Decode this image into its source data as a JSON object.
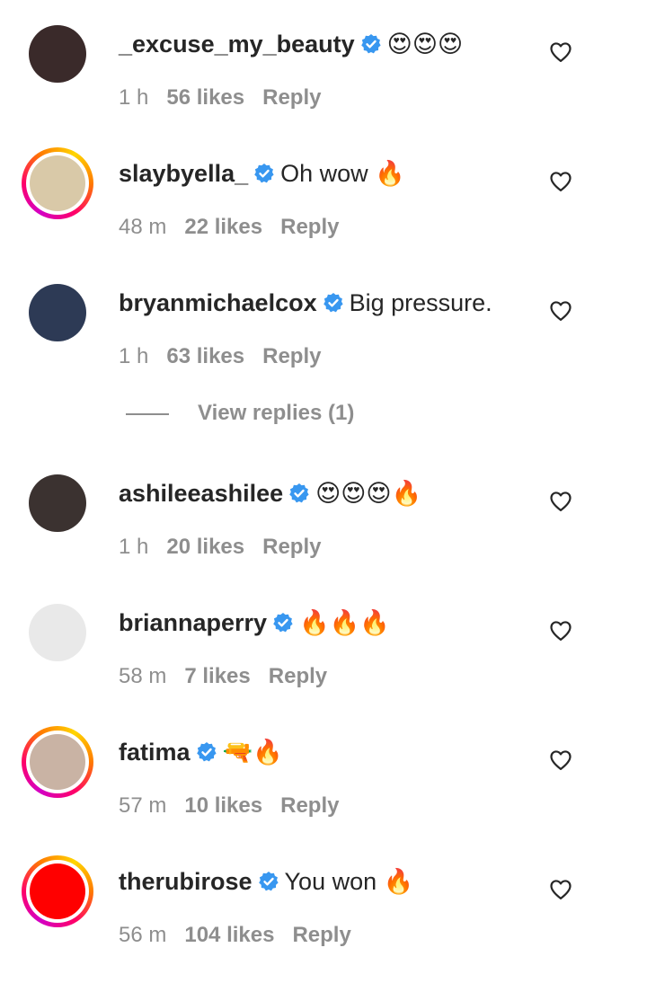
{
  "comments": [
    {
      "username": "_excuse_my_beauty",
      "text": "😍😍😍",
      "time": "1 h",
      "likes": "56 likes",
      "reply": "Reply",
      "avatar_color": "#3a2a2a",
      "story_ring": false
    },
    {
      "username": "slaybyella_",
      "text": "Oh wow 🔥",
      "time": "48 m",
      "likes": "22 likes",
      "reply": "Reply",
      "avatar_color": "#d9c9a8",
      "story_ring": true
    },
    {
      "username": "bryanmichaelcox",
      "text": "Big pressure.",
      "time": "1 h",
      "likes": "63 likes",
      "reply": "Reply",
      "avatar_color": "#2d3a55",
      "story_ring": false,
      "view_replies": "View replies (1)"
    },
    {
      "username": "ashileeashilee",
      "text": "😍😍😍🔥",
      "time": "1 h",
      "likes": "20 likes",
      "reply": "Reply",
      "avatar_color": "#3b3230",
      "story_ring": false
    },
    {
      "username": "briannaperry",
      "text": "🔥🔥🔥",
      "time": "58 m",
      "likes": "7 likes",
      "reply": "Reply",
      "avatar_color": "#e9e9e9",
      "story_ring": false
    },
    {
      "username": "fatima",
      "text": "🔫🔥",
      "time": "57 m",
      "likes": "10 likes",
      "reply": "Reply",
      "avatar_color": "#c9b3a4",
      "story_ring": true
    },
    {
      "username": "therubirose",
      "text": "You won 🔥",
      "time": "56 m",
      "likes": "104 likes",
      "reply": "Reply",
      "avatar_color": "#ff0000",
      "story_ring": true
    }
  ],
  "colors": {
    "verified": "#3897f0",
    "meta_text": "#8e8e8e",
    "primary_text": "#262626"
  },
  "icons": {
    "verified": "verified-badge-icon",
    "like": "heart-outline-icon"
  }
}
